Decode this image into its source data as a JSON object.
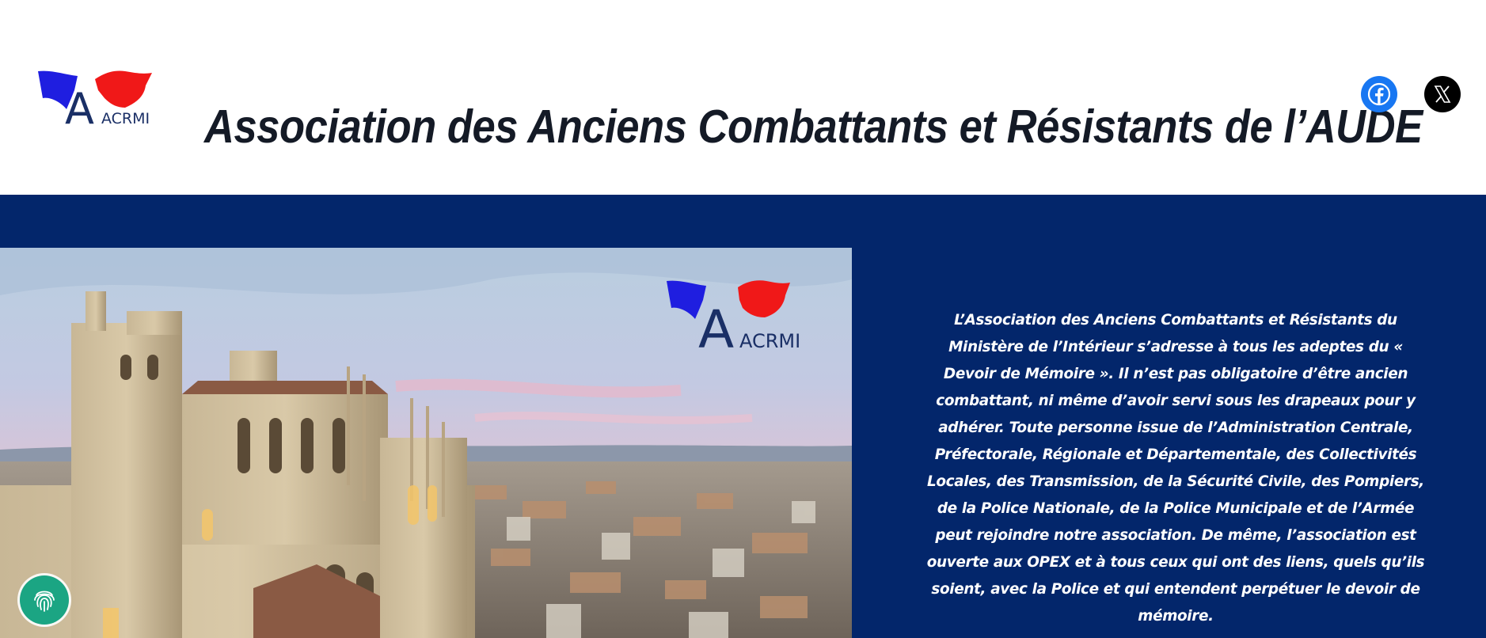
{
  "header": {
    "logo_text": "ACRMI",
    "title": "Association des Anciens Combattants et Résistants de l’AUDE",
    "social": [
      {
        "name": "Facebook",
        "icon": "facebook-icon",
        "color": "#1877f2"
      },
      {
        "name": "X",
        "icon": "x-icon",
        "color": "#000000"
      }
    ]
  },
  "hero": {
    "background_color": "#03266b",
    "image_logo_text": "ACRMI",
    "paragraph": "L’Association des Anciens Combattants et Résistants du Ministère de l’Intérieur s’adresse à tous les adeptes du « Devoir de Mémoire ». Il n’est pas obligatoire d’être ancien combattant, ni même d’avoir servi sous les drapeaux pour y adhérer. Toute personne issue de l’Administration Centrale, Préfectorale, Régionale et Départementale, des Collectivités Locales, des Transmission, de la Sécurité Civile, des Pompiers, de la Police Nationale, de la Police Municipale et de l’Armée peut rejoindre notre association. De même, l’association est ouverte aux OPEX et à tous ceux qui ont des liens, quels qu’ils soient, avec la Police et qui entendent perpétuer le devoir de mémoire."
  },
  "accessibility": {
    "icon": "fingerprint-icon",
    "color": "#1ba583"
  },
  "colors": {
    "flag_blue": "#1f1ee0",
    "flag_red": "#f01818",
    "logo_navy": "#1a2f66"
  }
}
